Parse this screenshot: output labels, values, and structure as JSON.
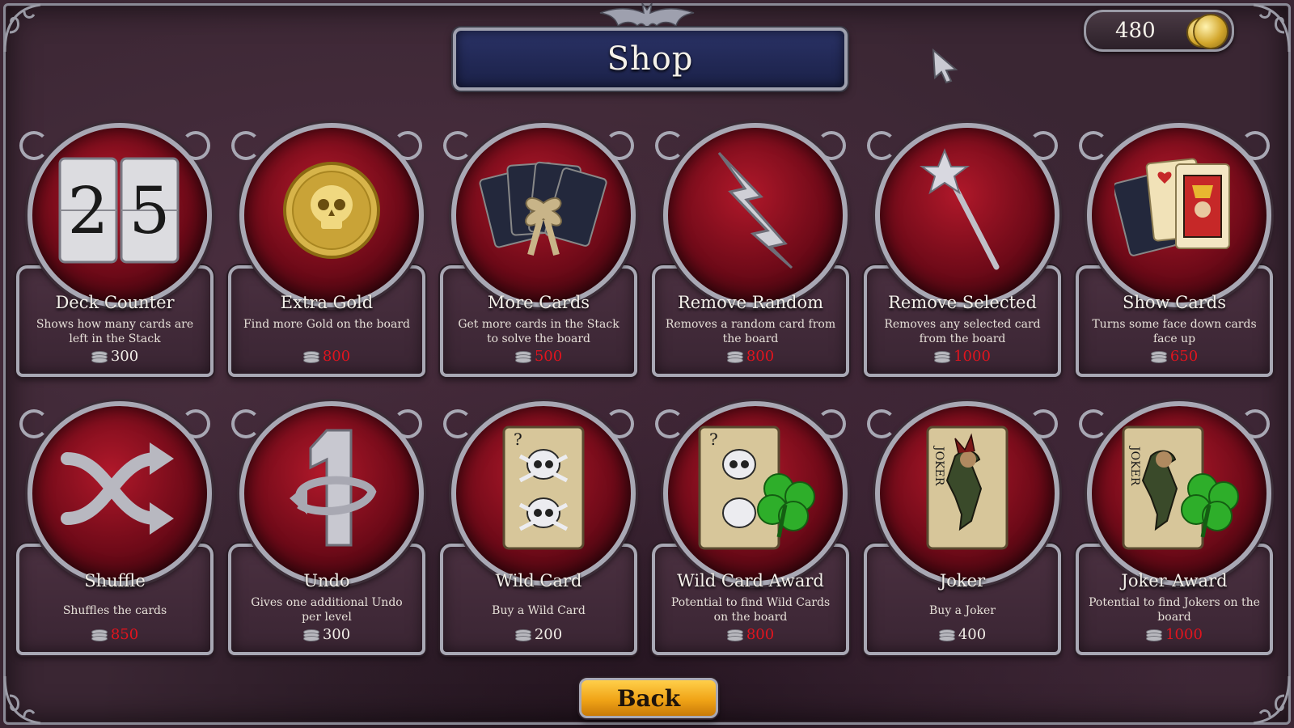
{
  "title": "Shop",
  "gold": {
    "amount": "480"
  },
  "back_label": "Back",
  "items": [
    {
      "name": "Deck Counter",
      "desc": "Shows how many cards are left in the Stack",
      "price": "300",
      "affordable": true,
      "icon": "deck-counter-icon",
      "icon_text": [
        "2",
        "5"
      ]
    },
    {
      "name": "Extra Gold",
      "desc": "Find more Gold on the board",
      "price": "800",
      "affordable": false,
      "icon": "skull-coin-icon"
    },
    {
      "name": "More Cards",
      "desc": "Get more cards in the Stack to solve the board",
      "price": "500",
      "affordable": false,
      "icon": "gift-cards-icon"
    },
    {
      "name": "Remove Random",
      "desc": "Removes a random card from the board",
      "price": "800",
      "affordable": false,
      "icon": "lightning-icon"
    },
    {
      "name": "Remove Selected",
      "desc": "Removes any selected card from the board",
      "price": "1000",
      "affordable": false,
      "icon": "magic-wand-icon"
    },
    {
      "name": "Show Cards",
      "desc": "Turns some face down cards face up",
      "price": "650",
      "affordable": false,
      "icon": "face-up-cards-icon"
    },
    {
      "name": "Shuffle",
      "desc": "Shuffles the cards",
      "price": "850",
      "affordable": false,
      "icon": "shuffle-icon"
    },
    {
      "name": "Undo",
      "desc": "Gives one additional Undo per level",
      "price": "300",
      "affordable": true,
      "icon": "undo-icon"
    },
    {
      "name": "Wild Card",
      "desc": "Buy a Wild Card",
      "price": "200",
      "affordable": true,
      "icon": "wild-card-icon"
    },
    {
      "name": "Wild Card Award",
      "desc": "Potential to find Wild Cards on the board",
      "price": "800",
      "affordable": false,
      "icon": "wild-card-clover-icon"
    },
    {
      "name": "Joker",
      "desc": "Buy a Joker",
      "price": "400",
      "affordable": true,
      "icon": "joker-card-icon"
    },
    {
      "name": "Joker Award",
      "desc": "Potential to find Jokers on the board",
      "price": "1000",
      "affordable": false,
      "icon": "joker-clover-icon"
    }
  ]
}
